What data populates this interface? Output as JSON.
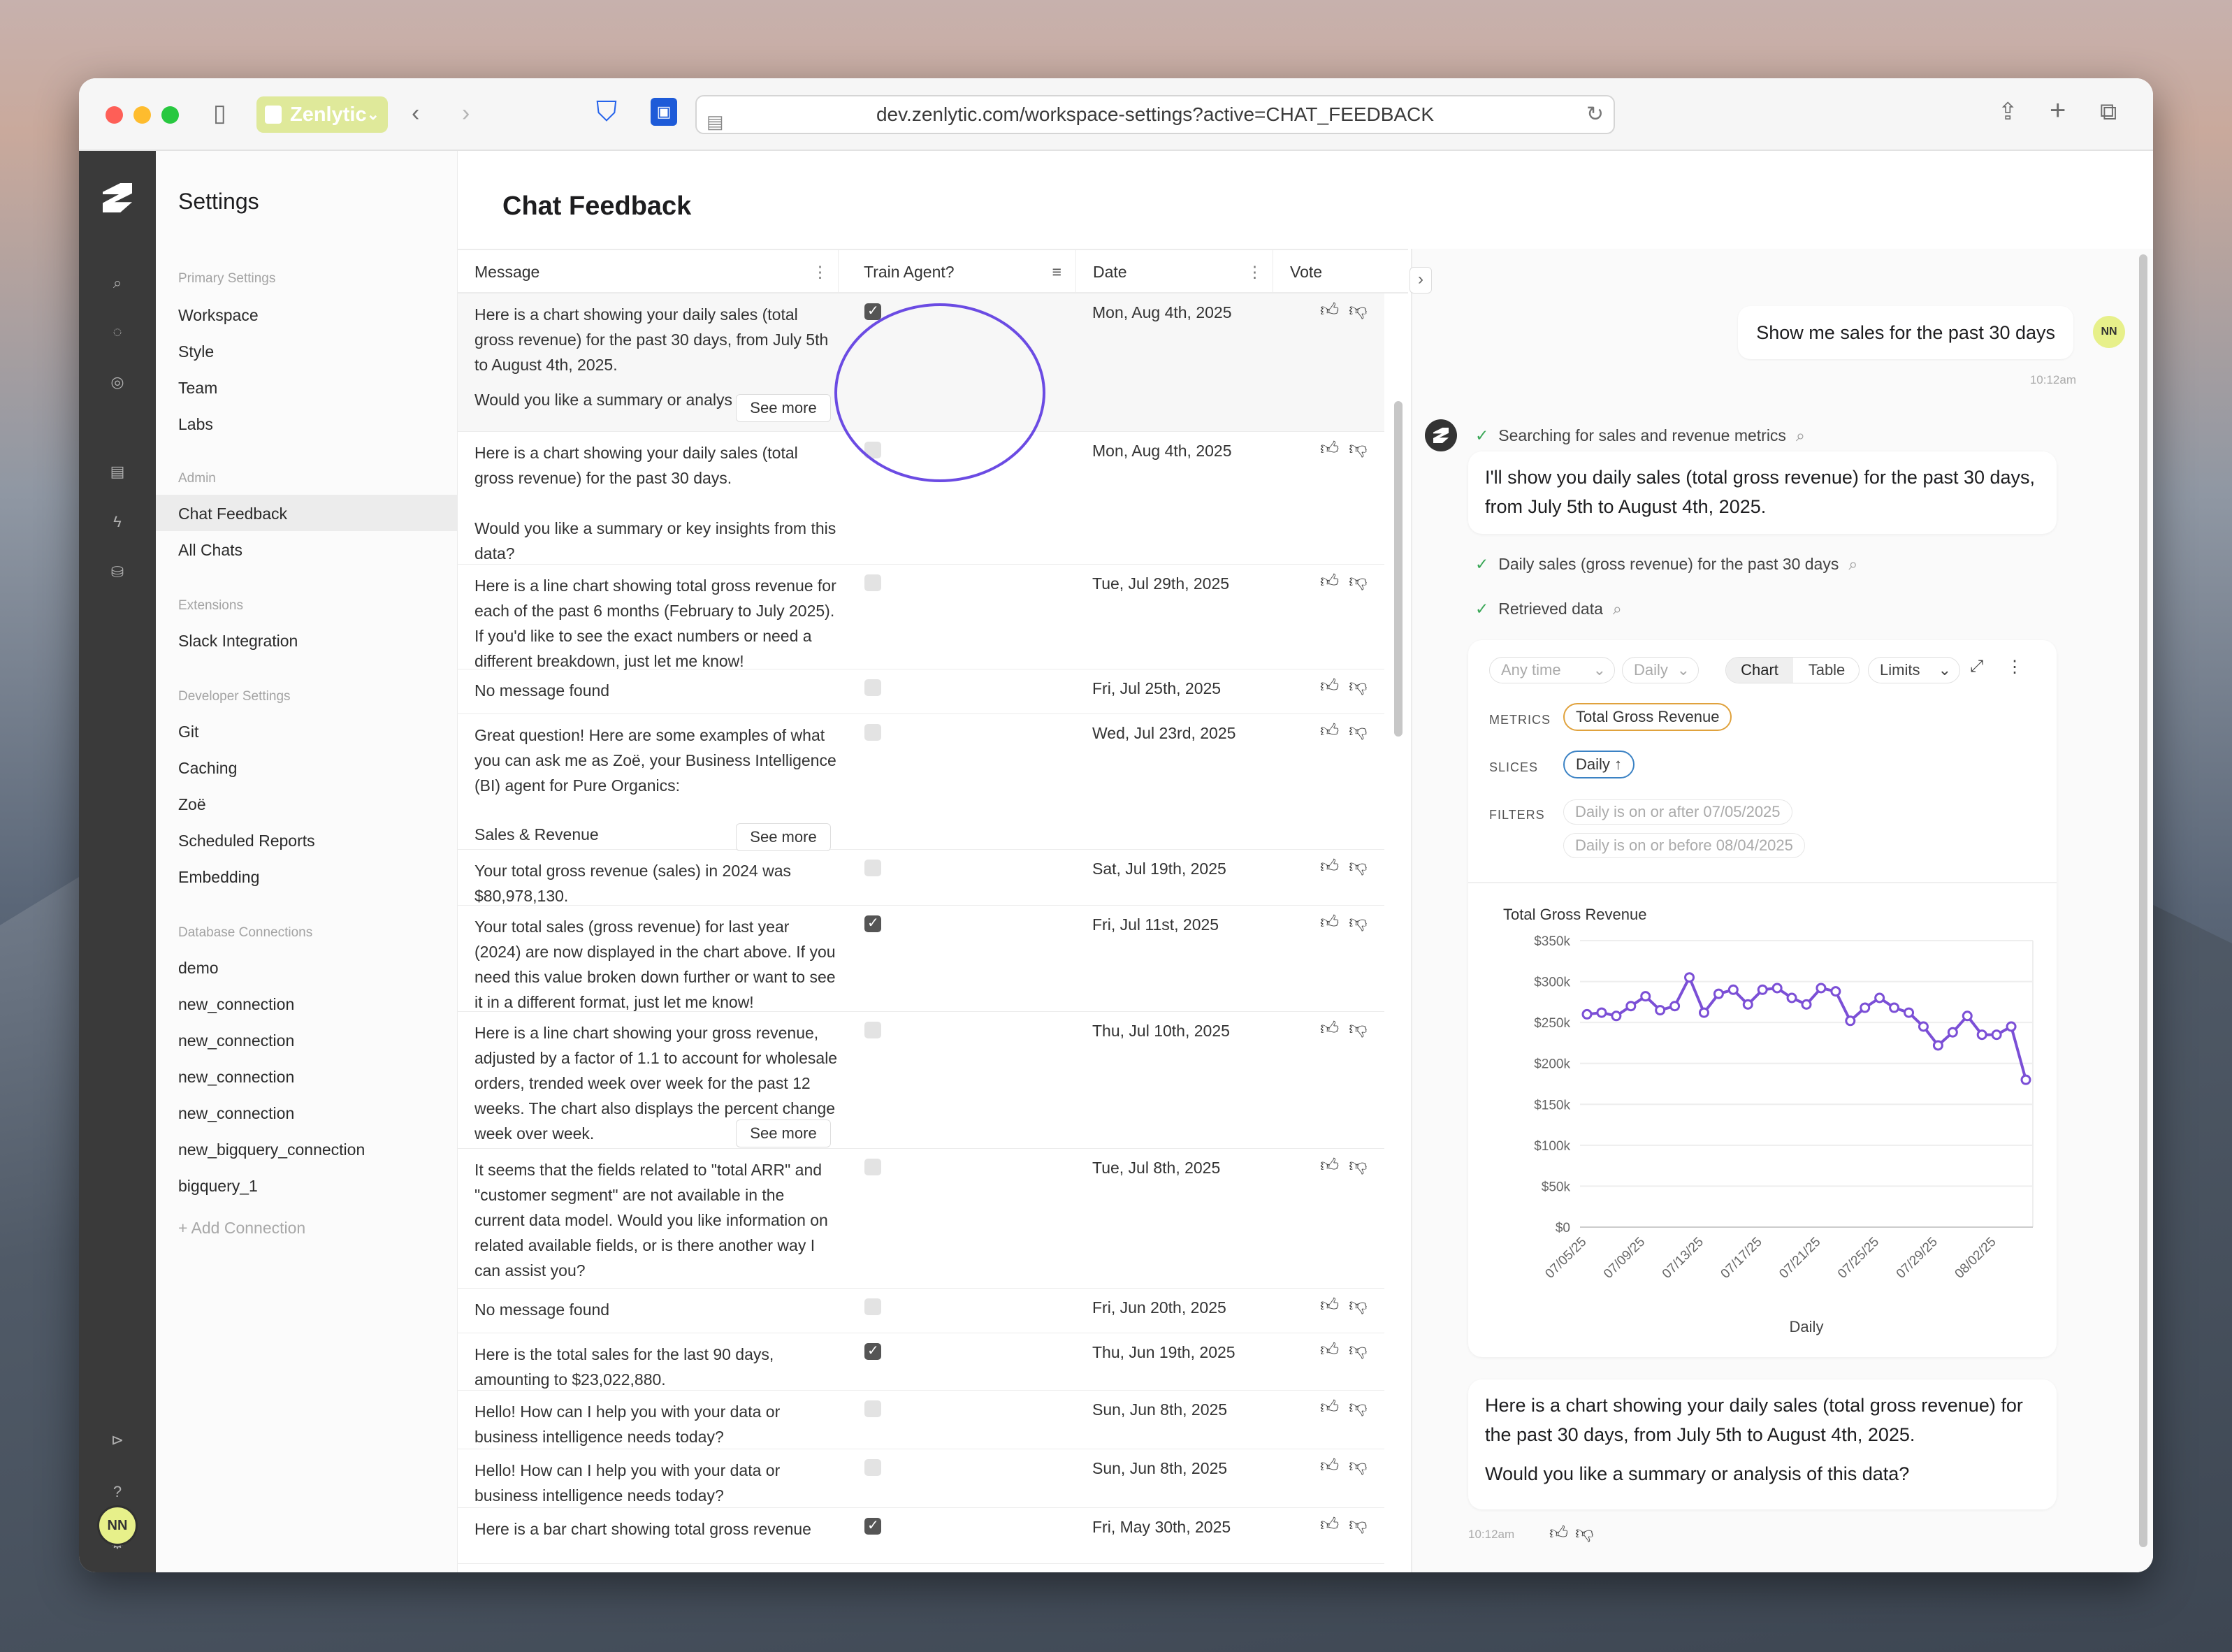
{
  "browser": {
    "tab_label": "Zenlytic",
    "url": "dev.zenlytic.com/workspace-settings?active=CHAT_FEEDBACK"
  },
  "user": {
    "initials": "NN"
  },
  "sidebar": {
    "title": "Settings",
    "primary_heading": "Primary Settings",
    "primary": [
      "Workspace",
      "Style",
      "Team",
      "Labs"
    ],
    "admin_heading": "Admin",
    "admin": [
      "Chat Feedback",
      "All Chats"
    ],
    "extensions_heading": "Extensions",
    "extensions": [
      "Slack Integration"
    ],
    "developer_heading": "Developer Settings",
    "developer": [
      "Git",
      "Caching",
      "Zoë",
      "Scheduled Reports",
      "Embedding"
    ],
    "db_heading": "Database Connections",
    "db": [
      "demo",
      "new_connection",
      "new_connection",
      "new_connection",
      "new_connection",
      "new_bigquery_connection",
      "bigquery_1"
    ],
    "add_connection": "+ Add Connection"
  },
  "page": {
    "title": "Chat Feedback"
  },
  "table": {
    "headers": {
      "message": "Message",
      "train": "Train Agent?",
      "date": "Date",
      "vote": "Vote"
    },
    "see_more": "See more",
    "rows": [
      {
        "msg": "Here is a chart showing your daily sales (total gross revenue) for the past 30 days, from July 5th to August 4th, 2025.",
        "msg2": "Would you like a summary or analys",
        "train": true,
        "date": "Mon, Aug 4th, 2025"
      },
      {
        "msg": "Here is a chart showing your daily sales (total gross revenue) for the past 30 days.",
        "msg2": "Would you like a summary or key insights from this data?",
        "train": false,
        "date": "Mon, Aug 4th, 2025"
      },
      {
        "msg": "Here is a line chart showing total gross revenue for each of the past 6 months (February to July 2025). If you'd like to see the exact numbers or need a different breakdown, just let me know!",
        "train": false,
        "date": "Tue, Jul 29th, 2025"
      },
      {
        "msg": "No message found",
        "train": false,
        "date": "Fri, Jul 25th, 2025"
      },
      {
        "msg": "Great question! Here are some examples of what you can ask me as Zoë, your Business Intelligence (BI) agent for Pure Organics:",
        "msg2": "Sales & Revenue",
        "train": false,
        "date": "Wed, Jul 23rd, 2025"
      },
      {
        "msg": "Your total gross revenue (sales) in 2024 was $80,978,130.",
        "train": false,
        "date": "Sat, Jul 19th, 2025"
      },
      {
        "msg": "Your total sales (gross revenue) for last year (2024) are now displayed in the chart above. If you need this value broken down further or want to see it in a different format, just let me know!",
        "train": true,
        "date": "Fri, Jul 11st, 2025"
      },
      {
        "msg": "Here is a line chart showing your gross revenue, adjusted by a factor of 1.1 to account for wholesale orders, trended week over week for the past 12 weeks. The chart also displays the percent change week over week.",
        "train": false,
        "date": "Thu, Jul 10th, 2025"
      },
      {
        "msg": "It seems that the fields related to \"total ARR\" and \"customer segment\" are not available in the current data model. Would you like information on related available fields, or is there another way I can assist you?",
        "train": false,
        "date": "Tue, Jul 8th, 2025"
      },
      {
        "msg": "No message found",
        "train": false,
        "date": "Fri, Jun 20th, 2025"
      },
      {
        "msg": "Here is the total sales for the last 90 days, amounting to $23,022,880.",
        "train": true,
        "date": "Thu, Jun 19th, 2025"
      },
      {
        "msg": "Hello! How can I help you with your data or business intelligence needs today?",
        "train": false,
        "date": "Sun, Jun 8th, 2025"
      },
      {
        "msg": "Hello! How can I help you with your data or business intelligence needs today?",
        "train": false,
        "date": "Sun, Jun 8th, 2025"
      },
      {
        "msg": "Here is a bar chart showing total gross revenue",
        "train": true,
        "date": "Fri, May 30th, 2025"
      }
    ]
  },
  "chat": {
    "user_message": "Show me sales for the past 30 days",
    "user_time": "10:12am",
    "step1": "Searching for sales and revenue metrics",
    "assistant_intro": "I'll show you daily sales (total gross revenue) for the past 30 days, from July 5th to August 4th, 2025.",
    "step2": "Daily sales (gross revenue) for the past 30 days",
    "step3": "Retrieved data",
    "controls": {
      "time": "Any time",
      "grain": "Daily",
      "chart": "Chart",
      "table": "Table",
      "limits": "Limits"
    },
    "metrics_label": "METRICS",
    "metric": "Total Gross Revenue",
    "slices_label": "SLICES",
    "slice": "Daily ↑",
    "filters_label": "FILTERS",
    "filter1_field": "Daily",
    "filter1_rest": "is on or after 07/05/2025",
    "filter2_field": "Daily",
    "filter2_rest": "is on or before 08/04/2025",
    "answer1": "Here is a chart showing your daily sales (total gross revenue) for the past 30 days, from July 5th to August 4th, 2025.",
    "answer2": "Would you like a summary or analysis of this data?",
    "answer_time": "10:12am"
  },
  "chart_data": {
    "type": "line",
    "title": "Total Gross Revenue",
    "xlabel": "Daily",
    "ylabel": "",
    "color": "#7b4fd6",
    "ylim": [
      0,
      350000
    ],
    "yticks": [
      "$0",
      "$50k",
      "$100k",
      "$150k",
      "$200k",
      "$250k",
      "$300k",
      "$350k"
    ],
    "xticks": [
      "07/05/25",
      "07/09/25",
      "07/13/25",
      "07/17/25",
      "07/21/25",
      "07/25/25",
      "07/29/25",
      "08/02/25"
    ],
    "x": [
      "07/05/25",
      "07/06/25",
      "07/07/25",
      "07/08/25",
      "07/09/25",
      "07/10/25",
      "07/11/25",
      "07/12/25",
      "07/13/25",
      "07/14/25",
      "07/15/25",
      "07/16/25",
      "07/17/25",
      "07/18/25",
      "07/19/25",
      "07/20/25",
      "07/21/25",
      "07/22/25",
      "07/23/25",
      "07/24/25",
      "07/25/25",
      "07/26/25",
      "07/27/25",
      "07/28/25",
      "07/29/25",
      "07/30/25",
      "07/31/25",
      "08/01/25",
      "08/02/25",
      "08/03/25",
      "08/04/25"
    ],
    "values": [
      260000,
      262000,
      258000,
      270000,
      282000,
      265000,
      270000,
      305000,
      262000,
      285000,
      290000,
      272000,
      290000,
      292000,
      280000,
      272000,
      292000,
      288000,
      252000,
      268000,
      280000,
      268000,
      262000,
      245000,
      222000,
      238000,
      258000,
      235000,
      235000,
      245000,
      180000
    ]
  }
}
